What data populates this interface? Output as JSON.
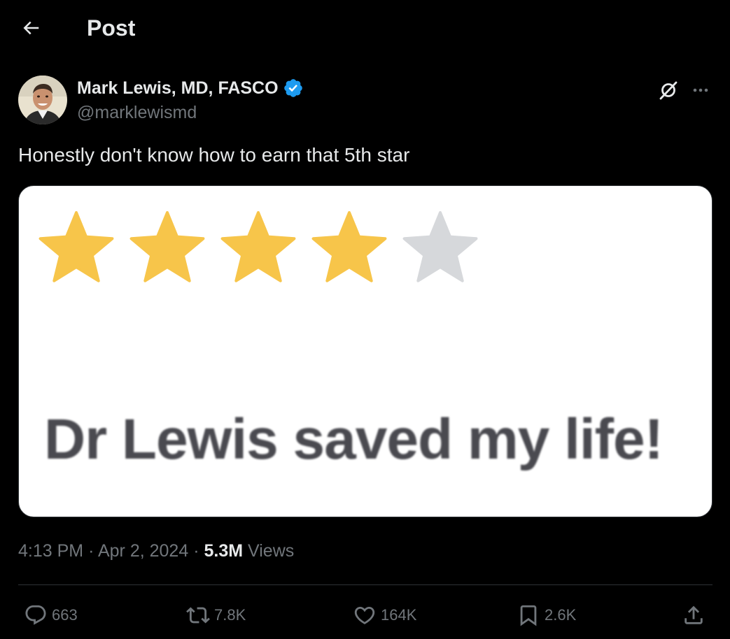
{
  "header": {
    "title": "Post"
  },
  "author": {
    "display_name": "Mark Lewis, MD, FASCO",
    "handle": "@marklewismd",
    "verified": true
  },
  "tweet": {
    "text": "Honestly don't know how to earn that 5th star"
  },
  "media": {
    "rating": {
      "value": 4,
      "max": 5
    },
    "review_text": "Dr Lewis saved my life!",
    "colors": {
      "star_filled": "#f7c54a",
      "star_empty": "#d6d8db"
    }
  },
  "meta": {
    "time": "4:13 PM",
    "separator": "·",
    "date": "Apr 2, 2024",
    "views_count": "5.3M",
    "views_label": "Views"
  },
  "actions": {
    "replies": "663",
    "reposts": "7.8K",
    "likes": "164K",
    "bookmarks": "2.6K"
  },
  "colors": {
    "background": "#000000",
    "text_primary": "#e7e9ea",
    "text_secondary": "#71767b",
    "verified_blue": "#1d9bf0",
    "divider": "#2f3336"
  }
}
